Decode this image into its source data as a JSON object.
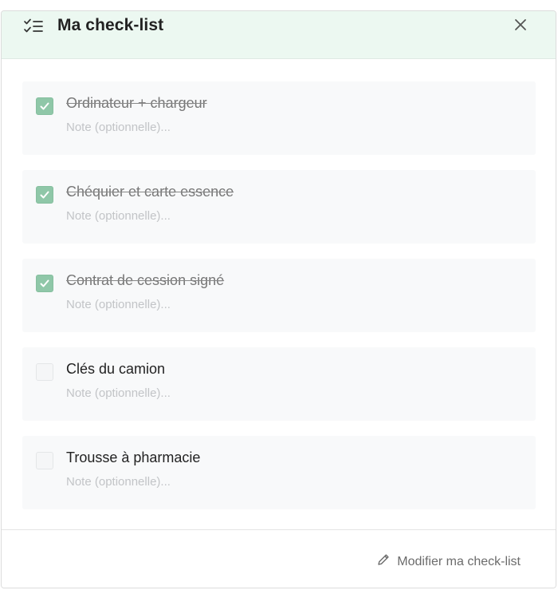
{
  "header": {
    "title": "Ma check-list",
    "list_icon": "checklist-icon",
    "close_icon": "close-icon"
  },
  "items": [
    {
      "label": "Ordinateur + chargeur",
      "checked": true,
      "note_placeholder": "Note (optionnelle)...",
      "note_value": ""
    },
    {
      "label": "Chéquier et carte essence",
      "checked": true,
      "note_placeholder": "Note (optionnelle)...",
      "note_value": ""
    },
    {
      "label": "Contrat de cession signé",
      "checked": true,
      "note_placeholder": "Note (optionnelle)...",
      "note_value": ""
    },
    {
      "label": "Clés du camion",
      "checked": false,
      "note_placeholder": "Note (optionnelle)...",
      "note_value": ""
    },
    {
      "label": "Trousse à pharmacie",
      "checked": false,
      "note_placeholder": "Note (optionnelle)...",
      "note_value": ""
    }
  ],
  "footer": {
    "edit_label": "Modifier ma check-list",
    "edit_icon": "pencil-icon"
  },
  "colors": {
    "header_bg": "#ecf8f1",
    "check_accent": "#8fc7a8",
    "item_bg": "#f8f9fa"
  }
}
